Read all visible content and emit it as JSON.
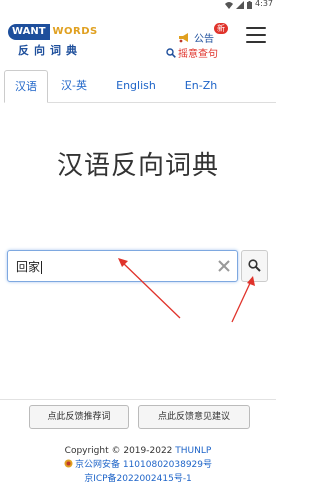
{
  "status_bar": {
    "time": "4:37"
  },
  "header": {
    "logo": {
      "want": "WANT",
      "words": "WORDS",
      "cn": "反向词典"
    },
    "notice": {
      "label": "公告",
      "badge": "新"
    },
    "random_query": {
      "label": "摇意查句"
    }
  },
  "tabs": [
    {
      "label": "汉语",
      "active": true
    },
    {
      "label": "汉-英",
      "active": false
    },
    {
      "label": "English",
      "active": false
    },
    {
      "label": "En-Zh",
      "active": false
    }
  ],
  "main": {
    "title": "汉语反向词典"
  },
  "search": {
    "value": "回家"
  },
  "feedback": {
    "recommend_label": "点此反馈推荐词",
    "opinion_label": "点此反馈意见建议"
  },
  "footer": {
    "copyright": "Copyright © 2019-2022",
    "org": "THUNLP",
    "police_record": "京公网安备 11010802038929号",
    "icp_record": "京ICP备2022002415号-1"
  },
  "colors": {
    "brand_blue": "#1e4f9c",
    "link_blue": "#1e64c8",
    "accent_red": "#e0332b",
    "logo_orange": "#e0a020"
  }
}
